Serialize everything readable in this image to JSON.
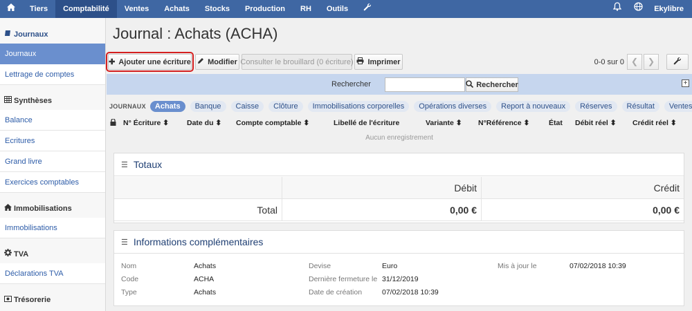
{
  "topnav": {
    "items": [
      "Tiers",
      "Comptabilité",
      "Ventes",
      "Achats",
      "Stocks",
      "Production",
      "RH",
      "Outils"
    ],
    "user": "Ekylibre"
  },
  "sidebar": {
    "journaux": {
      "header": "Journaux",
      "items": [
        "Journaux",
        "Lettrage de comptes"
      ]
    },
    "syntheses": {
      "header": "Synthèses",
      "items": [
        "Balance",
        "Ecritures",
        "Grand livre",
        "Exercices comptables"
      ]
    },
    "immobilisations": {
      "header": "Immobilisations",
      "items": [
        "Immobilisations"
      ]
    },
    "tva": {
      "header": "TVA",
      "items": [
        "Déclarations TVA"
      ]
    },
    "tresorerie": {
      "header": "Trésorerie"
    }
  },
  "page": {
    "title": "Journal : Achats (ACHA)"
  },
  "toolbar": {
    "add": "Ajouter une écriture",
    "edit": "Modifier",
    "draft": "Consulter le brouillard (0 écriture)",
    "print": "Imprimer",
    "pager": "0-0 sur 0"
  },
  "search": {
    "label": "Rechercher",
    "button": "Rechercher",
    "value": ""
  },
  "tabs": {
    "label": "JOURNAUX",
    "items": [
      "Achats",
      "Banque",
      "Caisse",
      "Clôture",
      "Immobilisations corporelles",
      "Opérations diverses",
      "Report à nouveaux",
      "Réserves",
      "Résultat",
      "Ventes"
    ],
    "active": "Achats"
  },
  "table": {
    "headers": [
      "N° Écriture",
      "Date du",
      "Compte comptable",
      "Libellé de l'écriture",
      "Variante",
      "N°Référence",
      "État",
      "Débit réel",
      "Crédit réel"
    ],
    "empty": "Aucun enregistrement"
  },
  "totals": {
    "title": "Totaux",
    "debit_label": "Débit",
    "credit_label": "Crédit",
    "total_label": "Total",
    "debit": "0,00 €",
    "credit": "0,00 €"
  },
  "info": {
    "title": "Informations complémentaires",
    "nom_k": "Nom",
    "nom_v": "Achats",
    "code_k": "Code",
    "code_v": "ACHA",
    "type_k": "Type",
    "type_v": "Achats",
    "devise_k": "Devise",
    "devise_v": "Euro",
    "fermeture_k": "Dernière fermeture le",
    "fermeture_v": "31/12/2019",
    "creation_k": "Date de création",
    "creation_v": "07/02/2018 10:39",
    "maj_k": "Mis à jour le",
    "maj_v": "07/02/2018 10:39"
  }
}
